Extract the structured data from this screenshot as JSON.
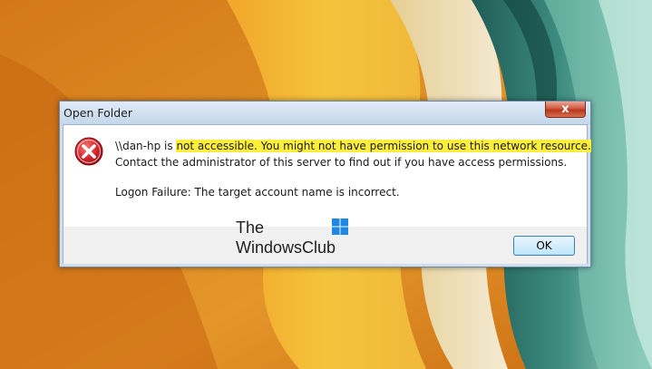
{
  "dialog": {
    "title": "Open Folder",
    "close_glyph": "x",
    "icon": "error-icon",
    "message_line1_prefix": "\\\\dan-hp is ",
    "message_line1_highlight": "not accessible. You might not have permission to use this network resource.",
    "message_line2": "Contact the administrator of this server to find out if you have access permissions.",
    "message_line3": "Logon Failure: The target account name is incorrect.",
    "ok_label": "OK"
  },
  "watermark": {
    "line1": "The",
    "line2": "WindowsClub",
    "logo_icon": "windows-logo-icon",
    "logo_color": "#1e88e5"
  },
  "colors": {
    "highlight": "#ffee3a",
    "error_red": "#c8102e",
    "close_button": "#c9452b"
  }
}
